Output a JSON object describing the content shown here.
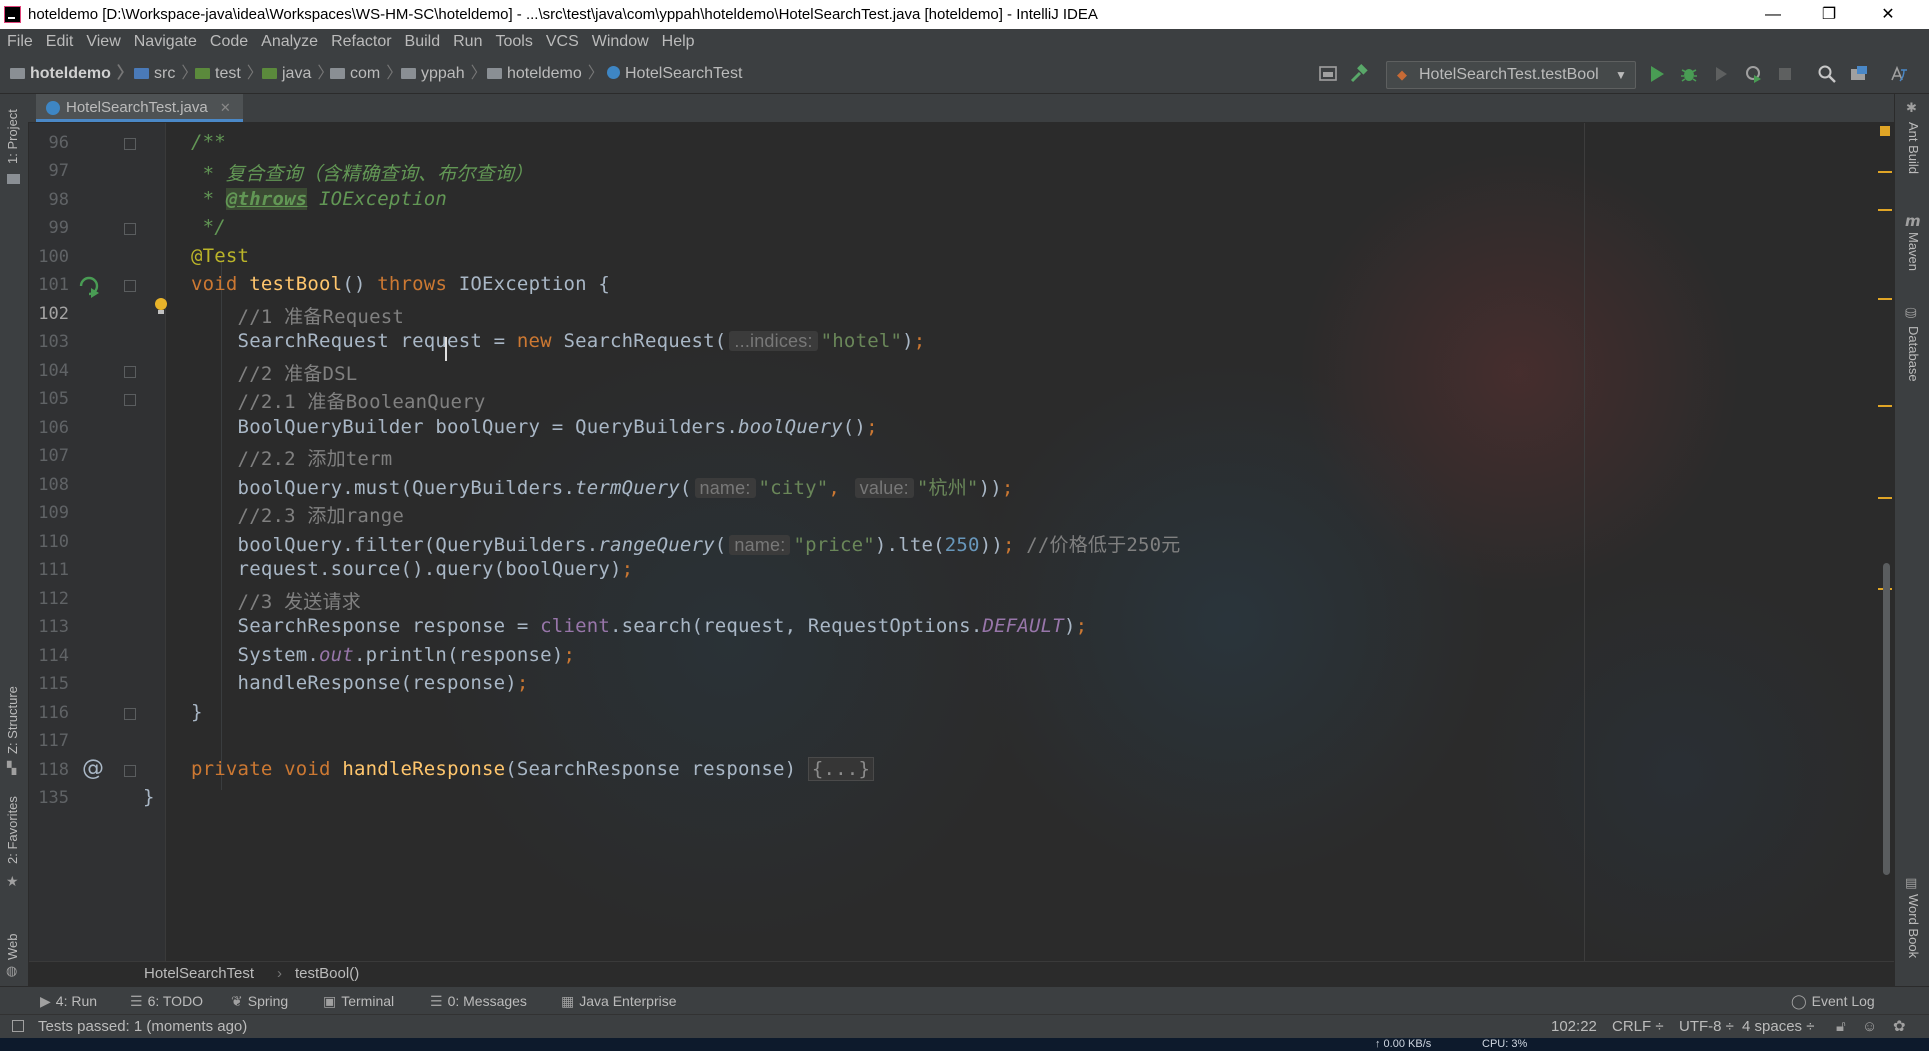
{
  "window": {
    "title": "hoteldemo [D:\\Workspace-java\\idea\\Workspaces\\WS-HM-SC\\hoteldemo] - ...\\src\\test\\java\\com\\yppah\\hoteldemo\\HotelSearchTest.java [hoteldemo] - IntelliJ IDEA",
    "minimize": "—",
    "maximize": "❐",
    "close": "✕"
  },
  "menu": [
    "File",
    "Edit",
    "View",
    "Navigate",
    "Code",
    "Analyze",
    "Refactor",
    "Build",
    "Run",
    "Tools",
    "VCS",
    "Window",
    "Help"
  ],
  "nav": {
    "crumbs": [
      "hoteldemo",
      "src",
      "test",
      "java",
      "com",
      "yppah",
      "hoteldemo",
      "HotelSearchTest"
    ],
    "run_config": "HotelSearchTest.testBool"
  },
  "tabs": [
    {
      "label": "HotelSearchTest.java",
      "close": "✕"
    }
  ],
  "left_tools": {
    "project": "1: Project",
    "structure": "Z: Structure",
    "favorites": "2: Favorites",
    "web": "Web"
  },
  "right_tools": {
    "ant": "Ant Build",
    "maven": "Maven",
    "database": "Database",
    "wordbook": "Word Book"
  },
  "gutter": {
    "line_numbers": [
      "96",
      "97",
      "98",
      "99",
      "100",
      "101",
      "102",
      "103",
      "104",
      "105",
      "106",
      "107",
      "108",
      "109",
      "110",
      "111",
      "112",
      "113",
      "114",
      "115",
      "116",
      "117",
      "118",
      "135"
    ],
    "current_line": "102",
    "override_marker": "@"
  },
  "code": {
    "l96": "/**",
    "l97_star": " * ",
    "l97_text": "复合查询（含精确查询、布尔查询）",
    "l98_star": " * ",
    "l98_tag": "@throws",
    "l98_text": " IOException",
    "l99": " */",
    "l100": "@Test",
    "l101_void": "void ",
    "l101_name": "testBool",
    "l101_parens": "() ",
    "l101_throws": "throws",
    "l101_rest": " IOException {",
    "l102": "    //1 准备Request",
    "l103_a": "    SearchRequest request = ",
    "l103_new": "new",
    "l103_b": " SearchRequest(",
    "l103_hint": "...indices:",
    "l103_str": "\"hotel\"",
    "l103_c": ")",
    "l103_semi": ";",
    "l104": "    //2 准备DSL",
    "l105": "    //2.1 准备BooleanQuery",
    "l106_a": "    BoolQueryBuilder boolQuery = QueryBuilders.",
    "l106_m": "boolQuery",
    "l106_b": "()",
    "l106_semi": ";",
    "l107": "    //2.2 添加term",
    "l108_a": "    boolQuery.must(QueryBuilders.",
    "l108_m": "termQuery",
    "l108_b": "(",
    "l108_hint1": "name:",
    "l108_s1": "\"city\"",
    "l108_comma": ", ",
    "l108_hint2": "value:",
    "l108_s2": "\"杭州\"",
    "l108_c": "))",
    "l108_semi": ";",
    "l109": "    //2.3 添加range",
    "l110_a": "    boolQuery.filter(QueryBuilders.",
    "l110_m": "rangeQuery",
    "l110_b": "(",
    "l110_hint": "name:",
    "l110_s": "\"price\"",
    "l110_c": ").lte(",
    "l110_num": "250",
    "l110_d": "))",
    "l110_semi": "; ",
    "l110_cm": "//价格低于250元",
    "l111_a": "    request.source().query(boolQuery)",
    "l111_semi": ";",
    "l112": "    //3 发送请求",
    "l113_a": "    SearchResponse response = ",
    "l113_f": "client",
    "l113_b": ".search(request, RequestOptions.",
    "l113_c": "DEFAULT",
    "l113_d": ")",
    "l113_semi": ";",
    "l114_a": "    System.",
    "l114_f": "out",
    "l114_b": ".println(response)",
    "l114_semi": ";",
    "l115_a": "    handleResponse(response)",
    "l115_semi": ";",
    "l116": "}",
    "l118_priv": "private void ",
    "l118_name": "handleResponse",
    "l118_rest": "(SearchResponse response) ",
    "l118_fold": "{...}",
    "l135": "}"
  },
  "breadcrumb": {
    "class": "HotelSearchTest",
    "method": "testBool()"
  },
  "tool_windows": [
    {
      "icon": "▶",
      "label": "4: Run"
    },
    {
      "icon": "☰",
      "label": "6: TODO"
    },
    {
      "icon": "❦",
      "label": "Spring"
    },
    {
      "icon": "▣",
      "label": "Terminal"
    },
    {
      "icon": "☰",
      "label": "0: Messages"
    },
    {
      "icon": "▦",
      "label": "Java Enterprise"
    }
  ],
  "event_log": "Event Log",
  "status": {
    "message": "Tests passed: 1 (moments ago)",
    "position": "102:22",
    "line_sep": "CRLF ÷",
    "encoding": "UTF-8 ÷",
    "indent": "4 spaces ÷"
  },
  "netbar": {
    "speed": "↑ 0.00 KB/s",
    "cpu": "CPU: 3%"
  },
  "colors": {
    "accent": "#4a88c7",
    "keyword": "#cc7832",
    "string": "#6a8759",
    "comment": "#808080",
    "doc": "#629755"
  }
}
